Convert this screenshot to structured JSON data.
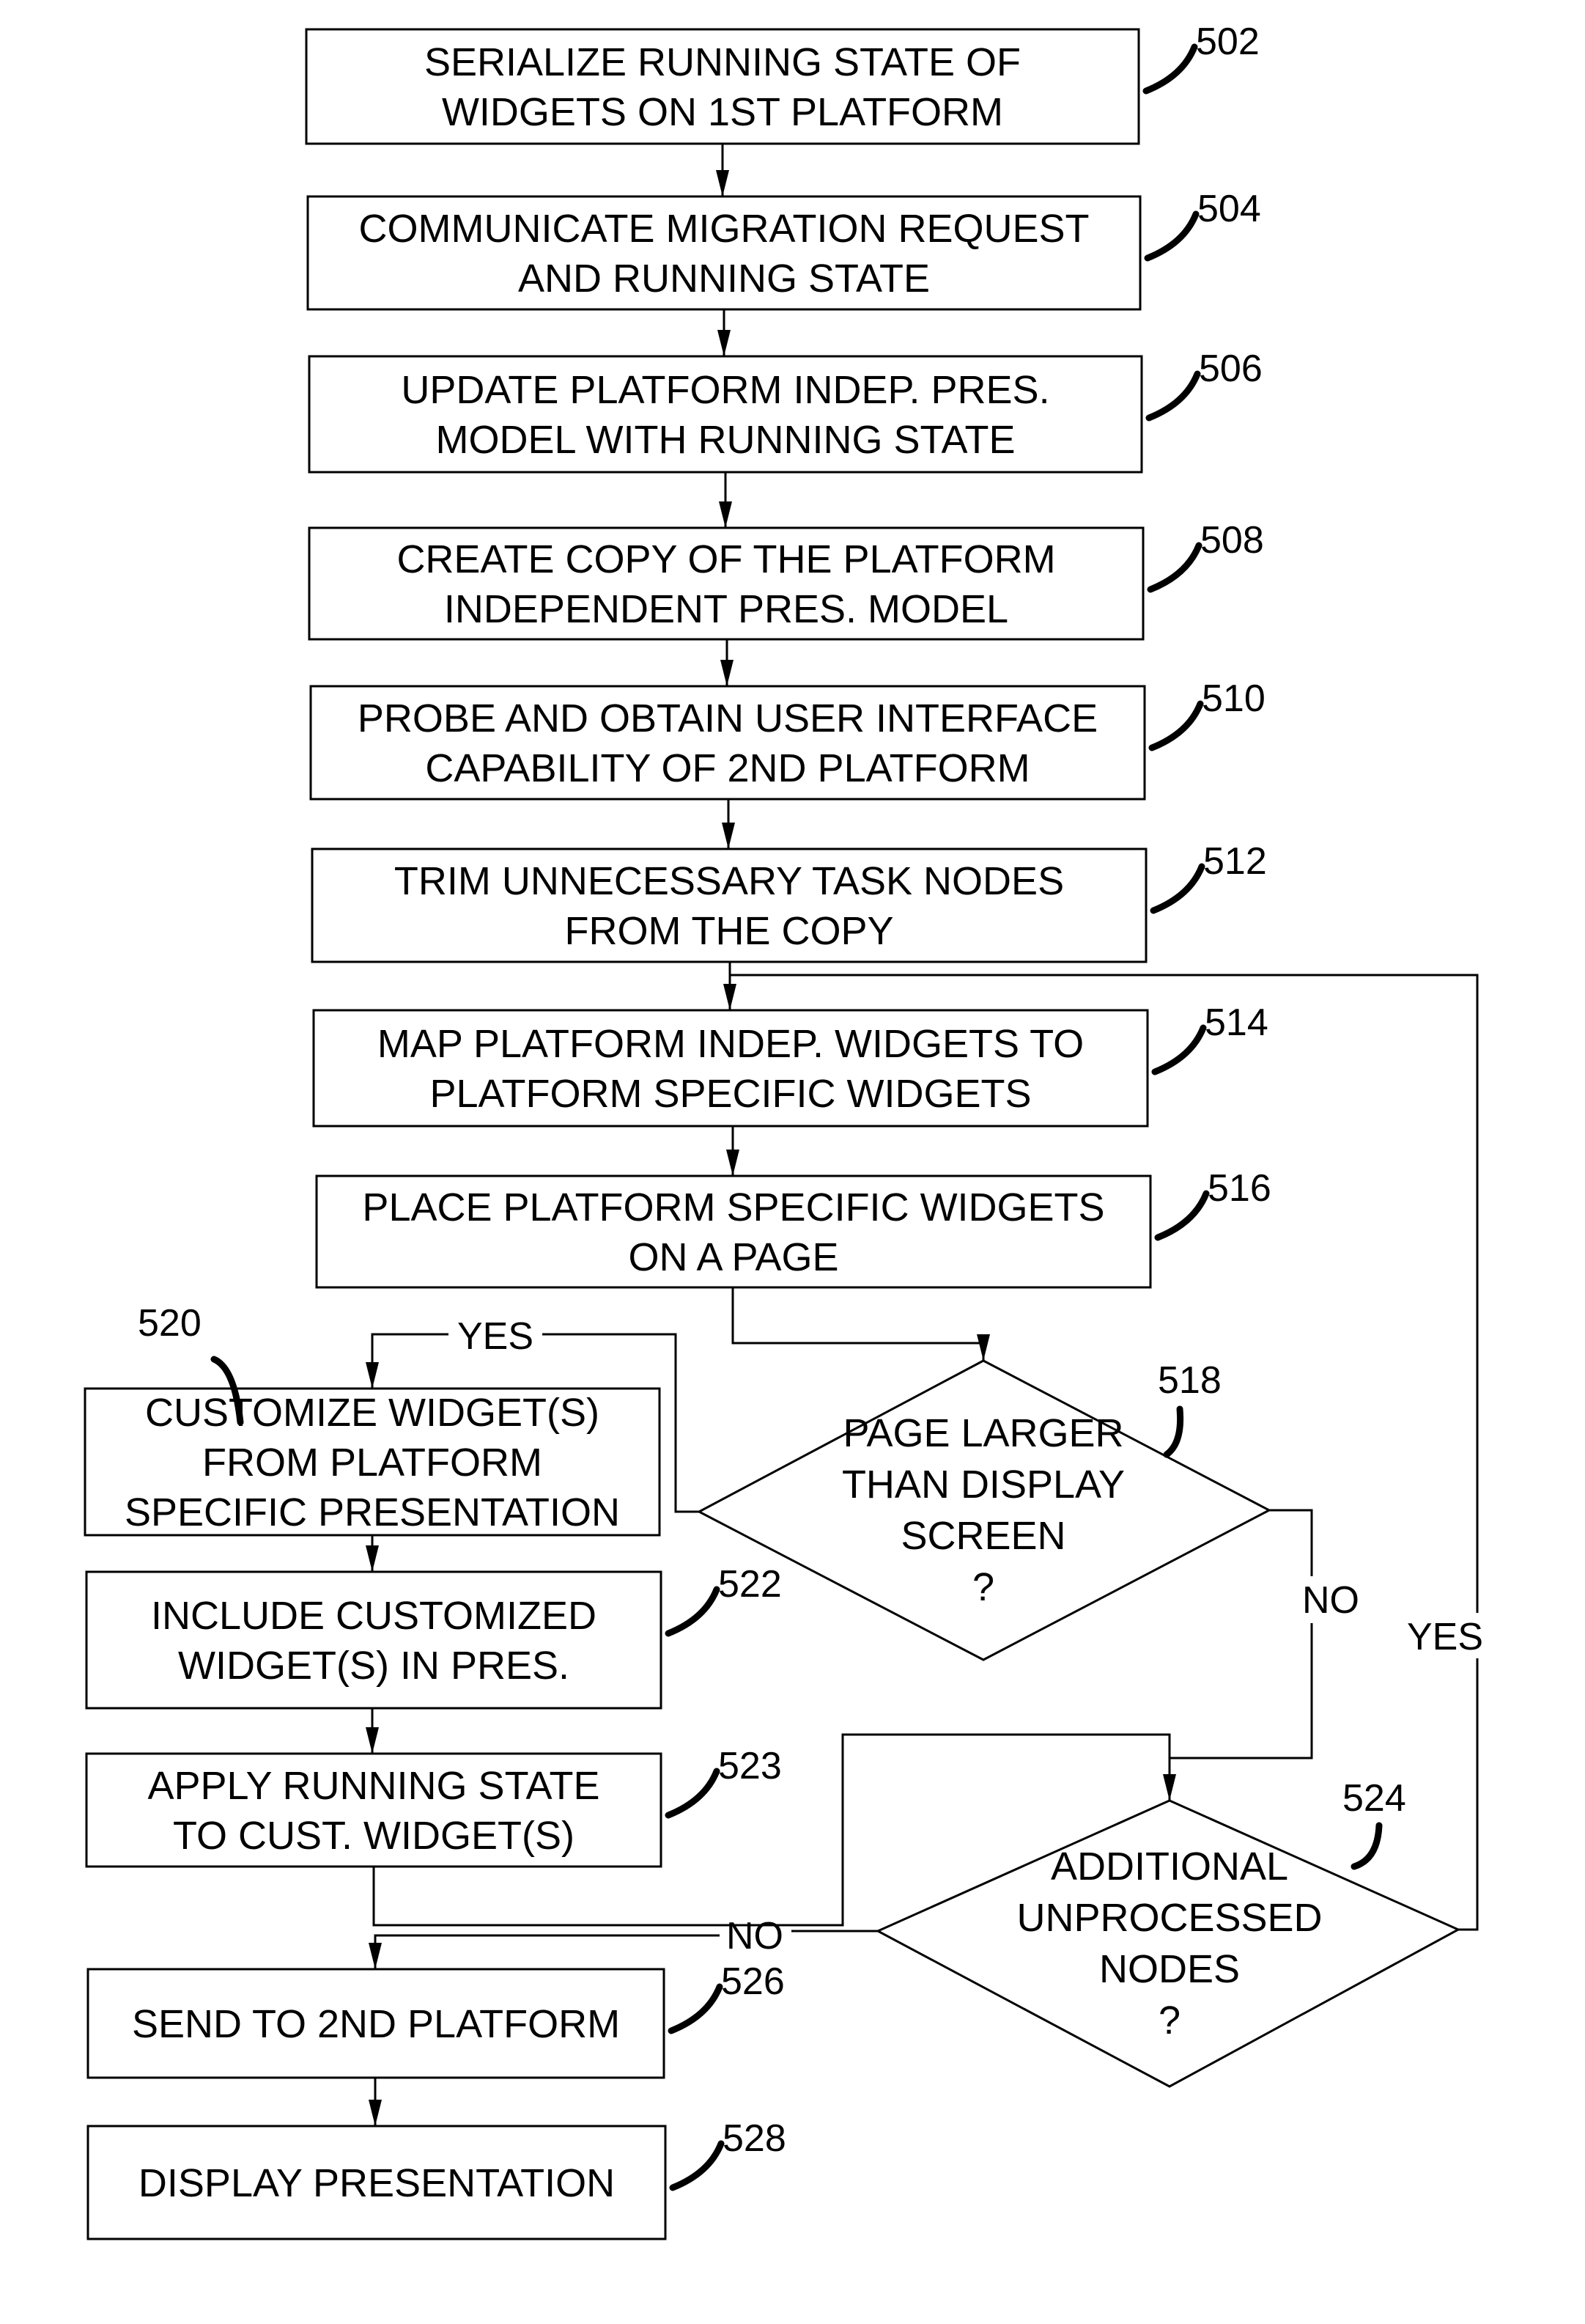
{
  "figure": {
    "type": "flowchart",
    "steps": [
      {
        "ref": "502",
        "lines": [
          "SERIALIZE RUNNING STATE OF",
          "WIDGETS ON 1ST PLATFORM"
        ]
      },
      {
        "ref": "504",
        "lines": [
          "COMMUNICATE MIGRATION REQUEST",
          "AND RUNNING STATE"
        ]
      },
      {
        "ref": "506",
        "lines": [
          "UPDATE PLATFORM INDEP.  PRES.",
          "MODEL WITH RUNNING STATE"
        ]
      },
      {
        "ref": "508",
        "lines": [
          "CREATE COPY OF THE PLATFORM",
          "INDEPENDENT PRES.  MODEL"
        ]
      },
      {
        "ref": "510",
        "lines": [
          "PROBE AND OBTAIN USER INTERFACE",
          "CAPABILITY OF 2ND PLATFORM"
        ]
      },
      {
        "ref": "512",
        "lines": [
          "TRIM UNNECESSARY TASK NODES",
          "FROM THE COPY"
        ]
      },
      {
        "ref": "514",
        "lines": [
          "MAP PLATFORM INDEP. WIDGETS TO",
          "PLATFORM SPECIFIC WIDGETS"
        ]
      },
      {
        "ref": "516",
        "lines": [
          "PLACE PLATFORM SPECIFIC WIDGETS",
          "ON A PAGE"
        ]
      },
      {
        "ref": "520",
        "lines": [
          "CUSTOMIZE WIDGET(S)",
          "FROM PLATFORM",
          "SPECIFIC PRESENTATION"
        ]
      },
      {
        "ref": "522",
        "lines": [
          "INCLUDE CUSTOMIZED",
          "WIDGET(S) IN PRES."
        ]
      },
      {
        "ref": "523",
        "lines": [
          "APPLY RUNNING STATE",
          "TO CUST. WIDGET(S)"
        ]
      },
      {
        "ref": "526",
        "lines": [
          "SEND TO 2ND PLATFORM"
        ]
      },
      {
        "ref": "528",
        "lines": [
          "DISPLAY PRESENTATION"
        ]
      }
    ],
    "decisions": [
      {
        "ref": "518",
        "lines": [
          "PAGE LARGER",
          "THAN DISPLAY",
          "SCREEN",
          "?"
        ],
        "yes_label": "YES",
        "no_label": "NO"
      },
      {
        "ref": "524",
        "lines": [
          "ADDITIONAL",
          "UNPROCESSED",
          "NODES",
          "?"
        ],
        "yes_label": "YES",
        "no_label": "NO"
      }
    ]
  }
}
